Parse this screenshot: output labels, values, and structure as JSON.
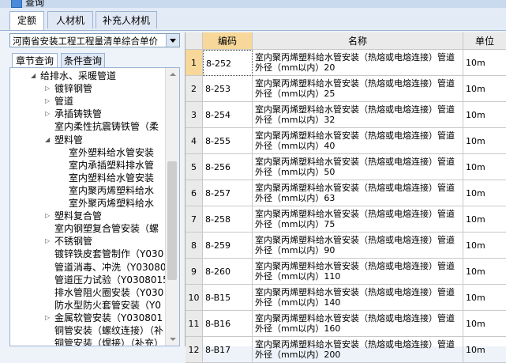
{
  "window": {
    "title": "查询"
  },
  "tabs": [
    "定额",
    "人材机",
    "补充人材机"
  ],
  "left_panel": {
    "library": "河南省安装工程工程量清单综合单价",
    "subtabs": [
      "章节查询",
      "条件查询"
    ],
    "tree": [
      {
        "label": "给排水、采暖管道",
        "level": 0,
        "state": "expanded"
      },
      {
        "label": "镀锌钢管",
        "level": 1,
        "state": "collapsed"
      },
      {
        "label": "管道",
        "level": 1,
        "state": "collapsed"
      },
      {
        "label": "承插铸铁管",
        "level": 1,
        "state": "collapsed"
      },
      {
        "label": "室内柔性抗震铸铁管（柔",
        "level": 1,
        "state": "leaf"
      },
      {
        "label": "塑料管",
        "level": 1,
        "state": "expanded"
      },
      {
        "label": "室外塑料给水管安装",
        "level": 2,
        "state": "leaf"
      },
      {
        "label": "室内承插塑料排水管",
        "level": 2,
        "state": "leaf"
      },
      {
        "label": "室内塑料给水管安装",
        "level": 2,
        "state": "leaf"
      },
      {
        "label": "室内聚丙烯塑料给水",
        "level": 2,
        "state": "leaf"
      },
      {
        "label": "室外聚丙烯塑料给水",
        "level": 2,
        "state": "leaf"
      },
      {
        "label": "塑料复合管",
        "level": 1,
        "state": "collapsed"
      },
      {
        "label": "室内钢塑复合管安装（螺",
        "level": 1,
        "state": "leaf"
      },
      {
        "label": "不锈钢管",
        "level": 1,
        "state": "collapsed"
      },
      {
        "label": "镀锌铁皮套管制作（Y030",
        "level": 1,
        "state": "leaf"
      },
      {
        "label": "管道消毒、冲洗（Y03080",
        "level": 1,
        "state": "leaf"
      },
      {
        "label": "管道压力试验（Y0308015",
        "level": 1,
        "state": "leaf"
      },
      {
        "label": "排水管阻火圈安装（Y030",
        "level": 1,
        "state": "leaf"
      },
      {
        "label": "防水型防火套管安装（Y0",
        "level": 1,
        "state": "leaf"
      },
      {
        "label": "金属软管安装（Y030801",
        "level": 1,
        "state": "collapsed"
      },
      {
        "label": "铜管安装（螺纹连接）（补",
        "level": 1,
        "state": "leaf"
      },
      {
        "label": "铜管安装（焊接）（补充）",
        "level": 1,
        "state": "leaf"
      }
    ]
  },
  "grid": {
    "columns": [
      "编码",
      "名称",
      "单位"
    ],
    "rows": [
      {
        "n": "1",
        "code": "8-252",
        "name": "室内聚丙烯塑料给水管安装（热熔或电熔连接）管道外径（mm以内）20",
        "unit": "10m"
      },
      {
        "n": "2",
        "code": "8-253",
        "name": "室内聚丙烯塑料给水管安装（热熔或电熔连接）管道外径（mm以内）25",
        "unit": "10m"
      },
      {
        "n": "3",
        "code": "8-254",
        "name": "室内聚丙烯塑料给水管安装（热熔或电熔连接）管道外径（mm以内）32",
        "unit": "10m"
      },
      {
        "n": "4",
        "code": "8-255",
        "name": "室内聚丙烯塑料给水管安装（热熔或电熔连接）管道外径（mm以内）40",
        "unit": "10m"
      },
      {
        "n": "5",
        "code": "8-256",
        "name": "室内聚丙烯塑料给水管安装（热熔或电熔连接）管道外径（mm以内）50",
        "unit": "10m"
      },
      {
        "n": "6",
        "code": "8-257",
        "name": "室内聚丙烯塑料给水管安装（热熔或电熔连接）管道外径（mm以内）63",
        "unit": "10m"
      },
      {
        "n": "7",
        "code": "8-258",
        "name": "室内聚丙烯塑料给水管安装（热熔或电熔连接）管道外径（mm以内）75",
        "unit": "10m"
      },
      {
        "n": "8",
        "code": "8-259",
        "name": "室内聚丙烯塑料给水管安装（热熔或电熔连接）管道外径（mm以内）90",
        "unit": "10m"
      },
      {
        "n": "9",
        "code": "8-260",
        "name": "室内聚丙烯塑料给水管安装（热熔或电熔连接）管道外径（mm以内）110",
        "unit": "10m"
      },
      {
        "n": "10",
        "code": "8-B15",
        "name": "室内聚丙烯塑料给水管安装（热熔或电熔连接）管道外径（mm以内）140",
        "unit": "10m"
      },
      {
        "n": "11",
        "code": "8-B16",
        "name": "室内聚丙烯塑料给水管安装（热熔或电熔连接）管道外径（mm以内）160",
        "unit": "10m"
      },
      {
        "n": "12",
        "code": "8-B17",
        "name": "室内聚丙烯塑料给水管安装（热熔或电熔连接）管道外径（mm以内）200",
        "unit": "10m"
      }
    ]
  }
}
